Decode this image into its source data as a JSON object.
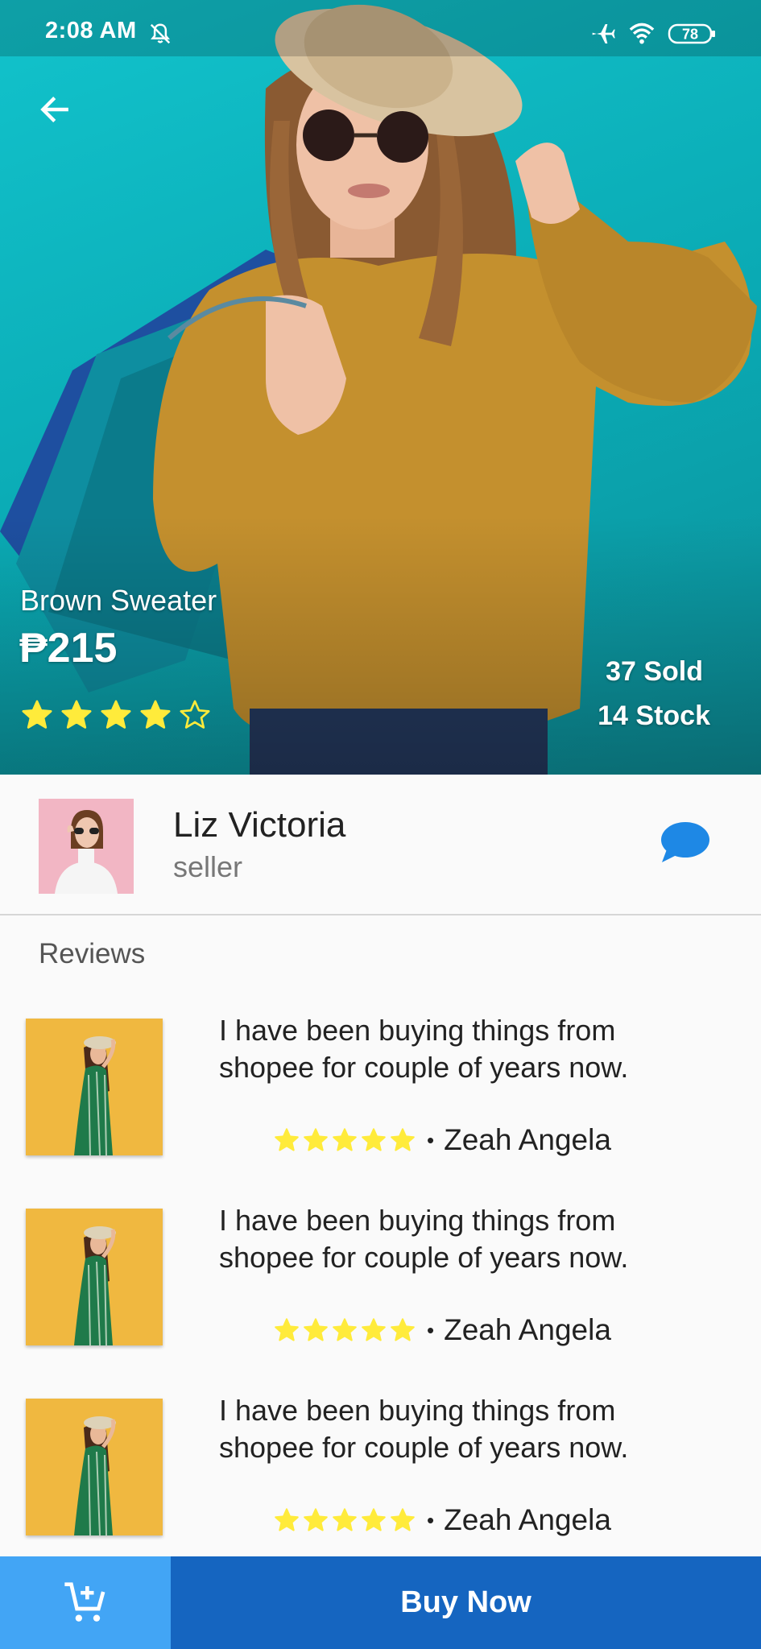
{
  "status_bar": {
    "time": "2:08 AM",
    "battery": "78",
    "icons": [
      "bell-off-icon",
      "airplane-icon",
      "wifi-icon",
      "battery-icon"
    ]
  },
  "product": {
    "name": "Brown Sweater",
    "price": "₱215",
    "rating": 4,
    "rating_max": 5,
    "sold": "37 Sold",
    "stock": "14 Stock"
  },
  "seller": {
    "name": "Liz Victoria",
    "role": "seller"
  },
  "reviews": {
    "heading": "Reviews",
    "items": [
      {
        "text": "I have been buying things from shopee for couple of years now.",
        "rating": 5,
        "author": "Zeah Angela"
      },
      {
        "text": "I have been buying things from shopee for couple of years now.",
        "rating": 5,
        "author": "Zeah Angela"
      },
      {
        "text": "I have been buying things from shopee for couple of years now.",
        "rating": 5,
        "author": "Zeah Angela"
      }
    ]
  },
  "bottom_bar": {
    "buy_label": "Buy Now"
  },
  "colors": {
    "star": "#ffeb3b",
    "accent": "#1565c0",
    "cart_bg": "#42a5f5",
    "chat": "#1e88e5",
    "hero_bg": "#12c3cc"
  }
}
